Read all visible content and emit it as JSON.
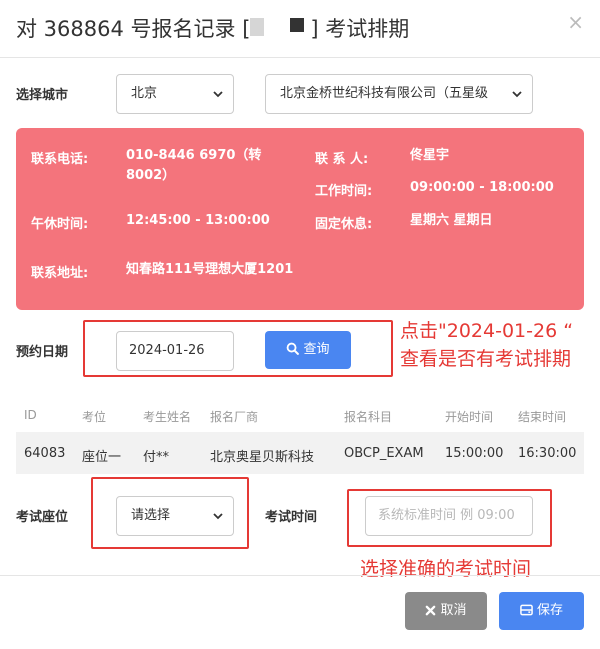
{
  "title": {
    "prefix": "对 368864 号报名记录 [",
    "suffix": "] 考试排期"
  },
  "close_glyph": "×",
  "city": {
    "label": "选择城市",
    "city_value": "北京",
    "vendor_value": "北京金桥世纪科技有限公司（五星级"
  },
  "info": {
    "phone_label": "联系电话:",
    "phone_value": "010-8446 6970（转8002）",
    "contact_label": "联 系 人:",
    "contact_value": "佟星宇",
    "worktime_label": "工作时间:",
    "worktime_value": "09:00:00 - 18:00:00",
    "lunch_label": "午休时间:",
    "lunch_value": "12:45:00 - 13:00:00",
    "rest_label": "固定休息:",
    "rest_value": "星期六 星期日",
    "address_label": "联系地址:",
    "address_value": "知春路111号理想大厦1201"
  },
  "date": {
    "label": "预约日期",
    "value": "2024-01-26",
    "query_label": "查询"
  },
  "annotations": {
    "query_line1": "点击\"2024-01-26 “",
    "query_line2": "查看是否有考试排期",
    "time_note": "选择准确的考试时间"
  },
  "table": {
    "headers": [
      "ID",
      "考位",
      "考生姓名",
      "报名厂商",
      "报名科目",
      "开始时间",
      "结束时间"
    ],
    "rows": [
      [
        "64083",
        "座位一",
        "付**",
        "北京奥星贝斯科技",
        "OBCP_EXAM",
        "15:00:00",
        "16:30:00"
      ]
    ]
  },
  "seat": {
    "label": "考试座位",
    "value": "请选择"
  },
  "exam_time": {
    "label": "考试时间",
    "placeholder": "系统标准时间 例 09:00"
  },
  "footer": {
    "cancel_label": "取消",
    "save_label": "保存"
  },
  "colors": {
    "info_bg": "#f4747c",
    "primary": "#4a86f1",
    "cancel": "#8a8a8a",
    "annotation": "#e53935"
  }
}
